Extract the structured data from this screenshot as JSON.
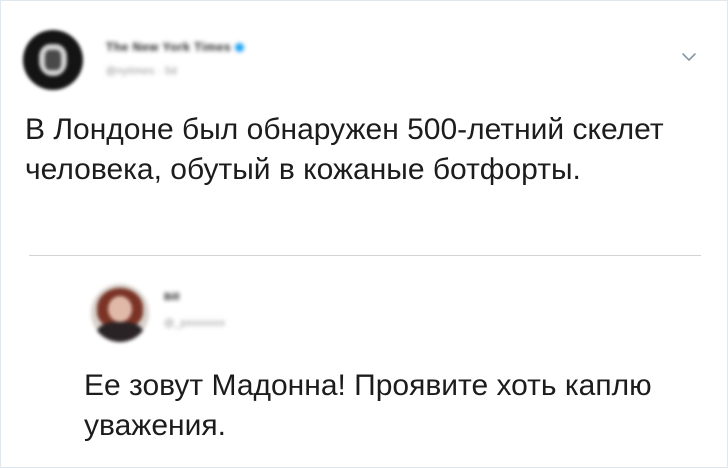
{
  "tweet": {
    "author_name": "The New York Times",
    "author_handle": "@nytimes · 5d",
    "text": "В Лондоне был обнаружен 500-летний скелет человека, обутый в кожаные ботфорты.",
    "menu_icon": "chevron-down-icon"
  },
  "reply": {
    "author_name": "Bill",
    "author_handle": "@_pxxxxxxx",
    "text": "Ее зовут Мадонна! Проявите хоть каплю уважения."
  },
  "colors": {
    "text": "#1c1c1c",
    "muted": "#8a8a8a",
    "divider": "#d3d3d3",
    "verified": "#1da1f2"
  }
}
